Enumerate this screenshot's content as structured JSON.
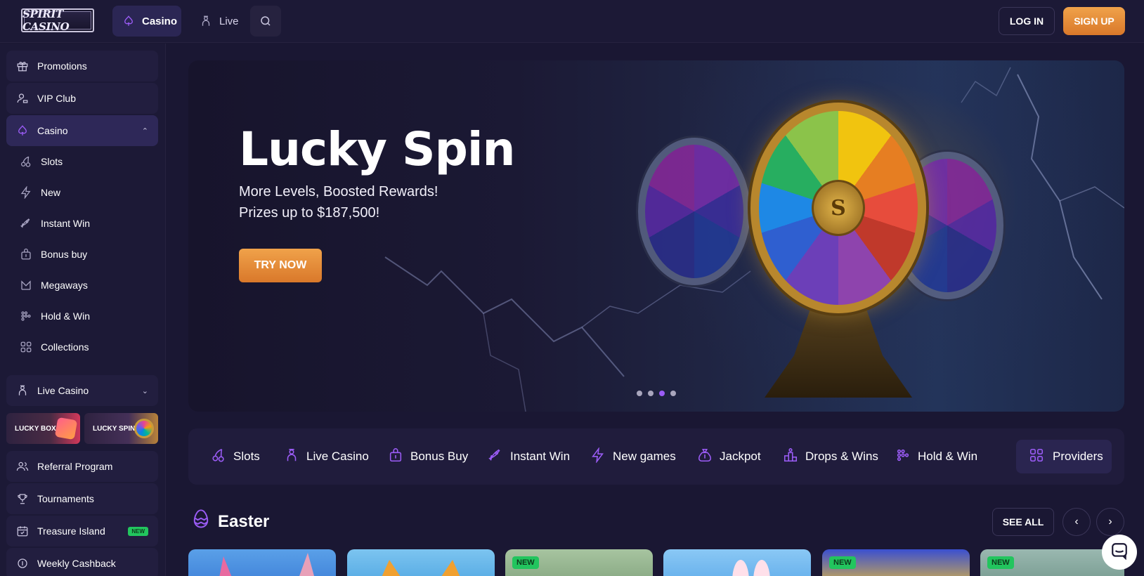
{
  "header": {
    "logo_text": "SPIRIT CASINO",
    "nav": [
      {
        "label": "Casino",
        "icon": "spade-icon"
      },
      {
        "label": "Live",
        "icon": "dealer-icon"
      }
    ],
    "login_label": "LOG IN",
    "signup_label": "SIGN UP"
  },
  "sidebar": {
    "top_items": [
      {
        "label": "Promotions",
        "icon": "gift-icon"
      },
      {
        "label": "VIP Club",
        "icon": "user-icon"
      }
    ],
    "casino": {
      "label": "Casino",
      "icon": "spade-icon",
      "expanded": true,
      "items": [
        {
          "label": "Slots",
          "icon": "cherries-icon"
        },
        {
          "label": "New",
          "icon": "lightning-icon"
        },
        {
          "label": "Instant Win",
          "icon": "rocket-icon"
        },
        {
          "label": "Bonus buy",
          "icon": "bag-icon"
        },
        {
          "label": "Megaways",
          "icon": "m-icon"
        },
        {
          "label": "Hold & Win",
          "icon": "dots-grid-icon"
        },
        {
          "label": "Collections",
          "icon": "grid-icon"
        }
      ]
    },
    "live_casino": {
      "label": "Live Casino",
      "icon": "dealer-icon"
    },
    "promo_tiles": [
      {
        "label": "LUCKY BOX"
      },
      {
        "label": "LUCKY SPIN"
      }
    ],
    "bottom_items": [
      {
        "label": "Referral Program",
        "icon": "users-icon"
      },
      {
        "label": "Tournaments",
        "icon": "trophy-icon"
      },
      {
        "label": "Treasure Island",
        "icon": "calendar-icon",
        "badge": "NEW"
      },
      {
        "label": "Weekly Cashback",
        "icon": "coin-icon"
      }
    ]
  },
  "hero": {
    "title": "Lucky Spin",
    "subtitle_line1": "More Levels, Boosted Rewards!",
    "subtitle_line2": "Prizes up to $187,500!",
    "cta_label": "TRY NOW",
    "wheel_emblem": "S",
    "slide_count": 4,
    "active_slide": 3
  },
  "categories": [
    {
      "label": "Slots",
      "icon": "cherries-icon"
    },
    {
      "label": "Live Casino",
      "icon": "dealer-icon"
    },
    {
      "label": "Bonus Buy",
      "icon": "bag-icon"
    },
    {
      "label": "Instant Win",
      "icon": "rocket-icon"
    },
    {
      "label": "New games",
      "icon": "lightning-icon"
    },
    {
      "label": "Jackpot",
      "icon": "money-bag-icon"
    },
    {
      "label": "Drops & Wins",
      "icon": "podium-icon"
    },
    {
      "label": "Hold & Win",
      "icon": "dots-grid-icon"
    }
  ],
  "providers_label": "Providers",
  "section": {
    "title": "Easter",
    "see_all_label": "SEE ALL",
    "new_tag": "NEW",
    "cards": [
      {
        "new": false
      },
      {
        "new": false
      },
      {
        "new": true
      },
      {
        "new": false
      },
      {
        "new": true
      },
      {
        "new": true
      }
    ]
  },
  "colors": {
    "background": "#1a1733",
    "accent_purple": "#9b5cf6",
    "cta_orange": "#e38a36",
    "new_badge_green": "#22c55e"
  }
}
